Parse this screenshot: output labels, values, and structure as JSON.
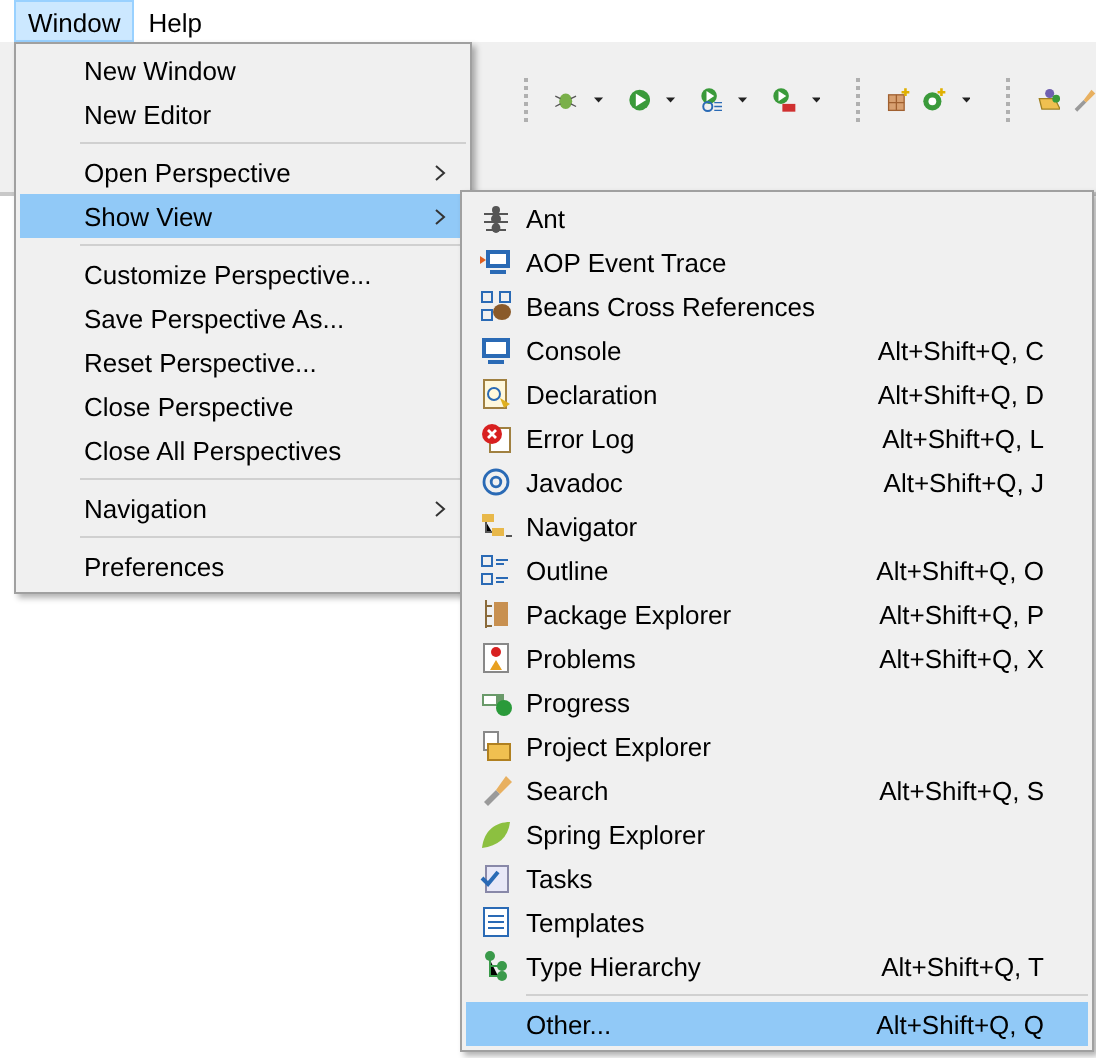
{
  "menubar": [
    {
      "label": "Window",
      "selected": true
    },
    {
      "label": "Help",
      "selected": false
    }
  ],
  "window_menu": [
    {
      "kind": "item",
      "label": "New Window",
      "submenu": false,
      "selected": false
    },
    {
      "kind": "item",
      "label": "New Editor",
      "submenu": false,
      "selected": false
    },
    {
      "kind": "separator"
    },
    {
      "kind": "item",
      "label": "Open Perspective",
      "submenu": true,
      "selected": false
    },
    {
      "kind": "item",
      "label": "Show View",
      "submenu": true,
      "selected": true
    },
    {
      "kind": "separator"
    },
    {
      "kind": "item",
      "label": "Customize Perspective...",
      "submenu": false,
      "selected": false
    },
    {
      "kind": "item",
      "label": "Save Perspective As...",
      "submenu": false,
      "selected": false
    },
    {
      "kind": "item",
      "label": "Reset Perspective...",
      "submenu": false,
      "selected": false
    },
    {
      "kind": "item",
      "label": "Close Perspective",
      "submenu": false,
      "selected": false
    },
    {
      "kind": "item",
      "label": "Close All Perspectives",
      "submenu": false,
      "selected": false
    },
    {
      "kind": "separator"
    },
    {
      "kind": "item",
      "label": "Navigation",
      "submenu": true,
      "selected": false
    },
    {
      "kind": "separator"
    },
    {
      "kind": "item",
      "label": "Preferences",
      "submenu": false,
      "selected": false
    }
  ],
  "show_view_menu": [
    {
      "kind": "item",
      "label": "Ant",
      "selected": false
    },
    {
      "kind": "item",
      "label": "AOP Event Trace",
      "selected": false
    },
    {
      "kind": "item",
      "label": "Beans Cross References",
      "selected": false
    },
    {
      "kind": "item",
      "label": "Console",
      "shortcut": "Alt+Shift+Q, C",
      "selected": false
    },
    {
      "kind": "item",
      "label": "Declaration",
      "shortcut": "Alt+Shift+Q, D",
      "selected": false
    },
    {
      "kind": "item",
      "label": "Error Log",
      "shortcut": "Alt+Shift+Q, L",
      "selected": false
    },
    {
      "kind": "item",
      "label": "Javadoc",
      "shortcut": "Alt+Shift+Q, J",
      "selected": false
    },
    {
      "kind": "item",
      "label": "Navigator",
      "selected": false
    },
    {
      "kind": "item",
      "label": "Outline",
      "shortcut": "Alt+Shift+Q, O",
      "selected": false
    },
    {
      "kind": "item",
      "label": "Package Explorer",
      "shortcut": "Alt+Shift+Q, P",
      "selected": false
    },
    {
      "kind": "item",
      "label": "Problems",
      "shortcut": "Alt+Shift+Q, X",
      "selected": false
    },
    {
      "kind": "item",
      "label": "Progress",
      "selected": false
    },
    {
      "kind": "item",
      "label": "Project Explorer",
      "selected": false
    },
    {
      "kind": "item",
      "label": "Search",
      "shortcut": "Alt+Shift+Q, S",
      "selected": false
    },
    {
      "kind": "item",
      "label": "Spring Explorer",
      "selected": false
    },
    {
      "kind": "item",
      "label": "Tasks",
      "selected": false
    },
    {
      "kind": "item",
      "label": "Templates",
      "selected": false
    },
    {
      "kind": "item",
      "label": "Type Hierarchy",
      "shortcut": "Alt+Shift+Q, T",
      "selected": false
    },
    {
      "kind": "separator"
    },
    {
      "kind": "item",
      "label": "Other...",
      "shortcut": "Alt+Shift+Q, Q",
      "selected": true
    }
  ]
}
